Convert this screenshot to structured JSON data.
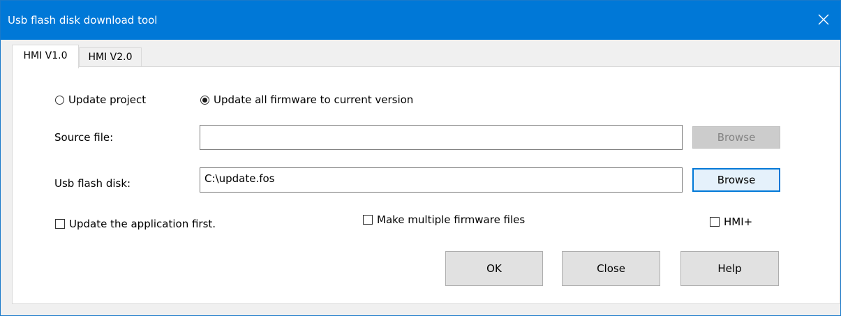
{
  "window": {
    "title": "Usb flash disk download tool"
  },
  "tabs": [
    {
      "label": "HMI V1.0",
      "selected": true
    },
    {
      "label": "HMI V2.0",
      "selected": false
    }
  ],
  "options": {
    "update_project": {
      "label": "Update project",
      "checked": false
    },
    "update_firmware": {
      "label": "Update all firmware to current version",
      "checked": true
    }
  },
  "source_file": {
    "label": "Source file:",
    "value": "",
    "browse_label": "Browse",
    "browse_enabled": false
  },
  "usb_disk": {
    "label": "Usb flash disk:",
    "value": "C:\\update.fos",
    "browse_label": "Browse",
    "browse_enabled": true
  },
  "checkboxes": {
    "update_app_first": {
      "label": "Update the application first.",
      "checked": false
    },
    "multiple_firmware": {
      "label": "Make multiple firmware files",
      "checked": false
    },
    "hmi_plus": {
      "label": "HMI+",
      "checked": false
    }
  },
  "buttons": {
    "ok": "OK",
    "close": "Close",
    "help": "Help"
  },
  "colors": {
    "titlebar": "#0078d7",
    "focus_border": "#0078d7"
  }
}
